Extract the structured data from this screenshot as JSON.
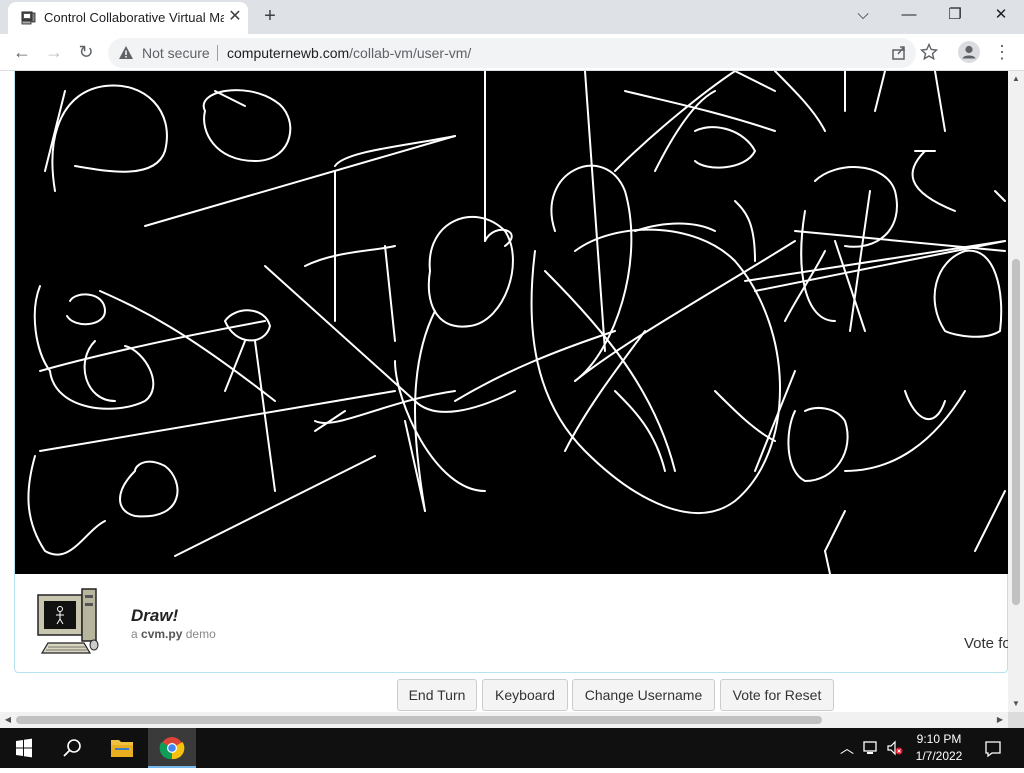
{
  "browser": {
    "tab_title": "Control Collaborative Virtual Ma",
    "not_secure_label": "Not secure",
    "url_domain": "computernewb.com",
    "url_path": "/collab-vm/user-vm/"
  },
  "vm": {
    "title": "Draw!",
    "subtitle_prefix": "a",
    "subtitle_link": "cvm.py",
    "subtitle_suffix": "demo",
    "vote_status": "Vote fo"
  },
  "buttons": {
    "end_turn": "End Turn",
    "keyboard": "Keyboard",
    "change_username": "Change Username",
    "vote_reset": "Vote for Reset"
  },
  "taskbar": {
    "time": "9:10 PM",
    "date": "1/7/2022"
  },
  "icons": {
    "tab_favicon": "computer-icon",
    "window_min": "minimize-icon",
    "window_max": "restore-icon",
    "window_close": "close-icon",
    "tab_search": "chevron-down-icon",
    "back": "back-arrow-icon",
    "forward": "forward-arrow-icon",
    "reload": "reload-icon",
    "warning": "warning-icon",
    "share": "share-icon",
    "bookmark": "star-icon",
    "profile": "profile-icon",
    "menu": "more-vert-icon",
    "start": "windows-start-icon",
    "search": "search-icon",
    "explorer": "folder-icon",
    "chrome": "chrome-icon",
    "tray_chevron": "chevron-up-icon",
    "network": "network-icon",
    "volume": "volume-muted-icon",
    "notifications": "notification-icon"
  },
  "colors": {
    "vm_background": "#000000",
    "vm_stroke": "#ffffff",
    "panel_border": "#b7e3ef",
    "taskbar": "#101010"
  }
}
